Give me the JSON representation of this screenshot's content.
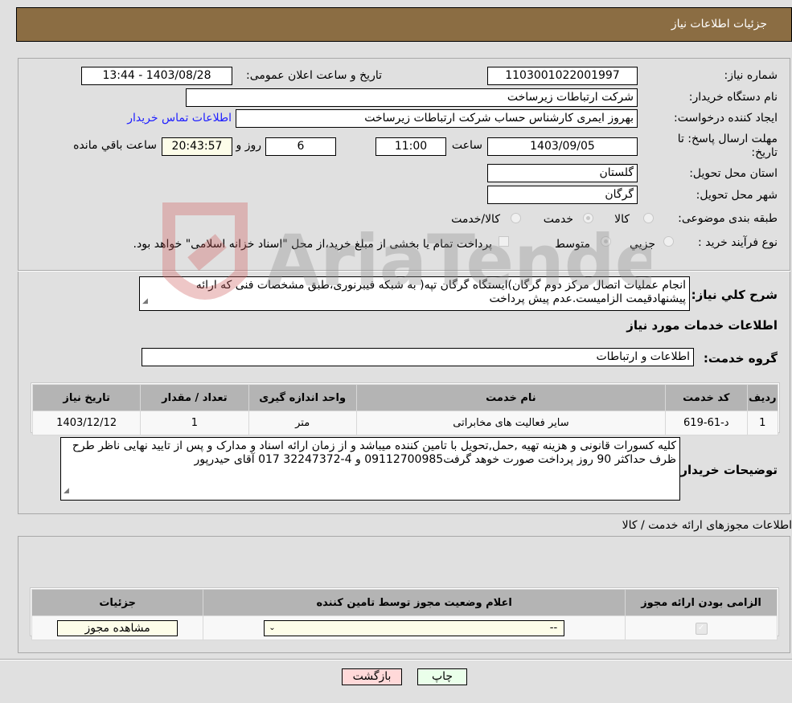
{
  "header": {
    "title": "جزئیات اطلاعات نیاز"
  },
  "form": {
    "need_number": {
      "label": "شماره نیاز:",
      "value": "1103001022001997"
    },
    "announce_datetime": {
      "label": "تاریخ و ساعت اعلان عمومی:",
      "value": "1403/08/28 - 13:44"
    },
    "buyer_org": {
      "label": "نام دستگاه خریدار:",
      "value": "شرکت ارتباطات زیرساخت"
    },
    "requester": {
      "label": "ایجاد کننده درخواست:",
      "value": "بهروز ایمری کارشناس حساب شرکت ارتباطات زیرساخت",
      "contact_link": "اطلاعات تماس خریدار"
    },
    "deadline": {
      "label": "مهلت ارسال پاسخ: تا تاریخ:",
      "date": "1403/09/05",
      "time_label": "ساعت",
      "time": "11:00",
      "days": "6",
      "days_label": "روز و",
      "remaining": "20:43:57",
      "remaining_label": "ساعت باقي مانده"
    },
    "province": {
      "label": "استان محل تحویل:",
      "value": "گلستان"
    },
    "city": {
      "label": "شهر محل تحویل:",
      "value": "گرگان"
    },
    "category": {
      "label": "طبقه بندی موضوعی:",
      "options": [
        "کالا",
        "خدمت",
        "کالا/خدمت"
      ],
      "selected": "خدمت"
    },
    "purchase_type": {
      "label": "نوع فرآیند خرید :",
      "options": [
        "جزيي",
        "متوسط"
      ],
      "selected": "متوسط",
      "treasury_note": "پرداخت تمام یا بخشی از مبلغ خرید،از محل \"اسناد خزانه اسلامی\" خواهد بود."
    },
    "description": {
      "label": "شرح کلي نياز:",
      "value": "انجام عملیات اتصال مرکز دوم گرگان)ایستگاه گرگان تپه( به شبکه فیبرنوری،طبق مشخصات فنی که ارائه پیشنهادقیمت الزامیست.عدم پیش پرداخت"
    }
  },
  "services": {
    "section_title": "اطلاعات خدمات مورد نیاز",
    "group_label": "گروه خدمت:",
    "group_value": "اطلاعات و ارتباطات",
    "table": {
      "headers": [
        "ردیف",
        "کد خدمت",
        "نام خدمت",
        "واحد اندازه گیری",
        "تعداد / مقدار",
        "تاریخ نیاز"
      ],
      "rows": [
        [
          "1",
          "د-61-619",
          "سایر فعالیت های مخابراتی",
          "متر",
          "1",
          "1403/12/12"
        ]
      ]
    },
    "buyer_notes_label": "توضیحات خریدار:",
    "buyer_notes": "کلیه کسورات قانونی و هزینه تهیه ,حمل,تحویل با تامین کننده میباشد و از زمان ارائه اسناد و مدارک و پس از تایید نهایی ناظر طرح ظرف حداکثر 90 روز پرداخت صورت خوهد گرفت09112700985  و 4-32247372 017  آقای حیدرپور"
  },
  "licenses": {
    "section_title": "اطلاعات مجوزهای ارائه خدمت / کالا",
    "headers": [
      "الزامی بودن ارائه مجوز",
      "اعلام وضعیت مجوز توسط تامین کننده",
      "جزئیات"
    ],
    "row": {
      "required_checked": true,
      "status_select": "--",
      "details_button": "مشاهده مجوز"
    }
  },
  "buttons": {
    "print": "چاپ",
    "back": "بازگشت"
  },
  "watermark": "AriaTender.net",
  "colors": {
    "header_bg": "#8b6d43",
    "link": "#2020ff",
    "print_btn": "#eaffea",
    "back_btn": "#ffd9d9",
    "remaining_bg": "#fdfde9"
  }
}
